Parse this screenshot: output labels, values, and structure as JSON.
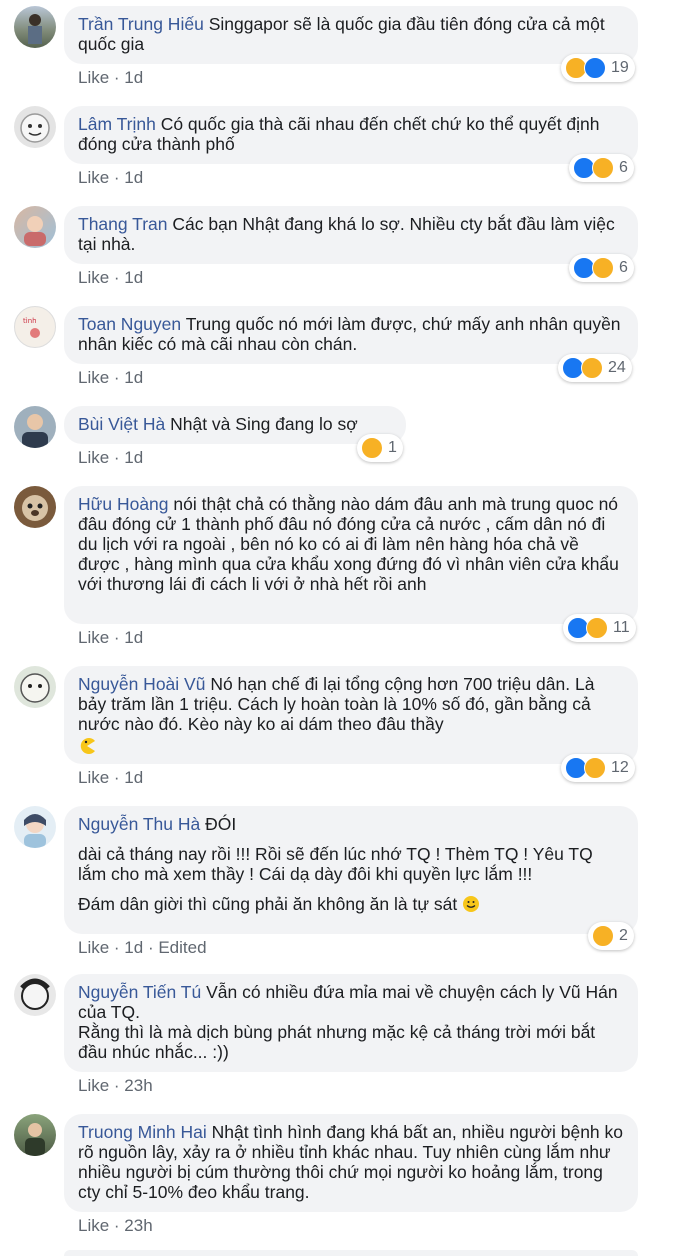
{
  "comments": [
    {
      "author": "Trần Trung Hiếu",
      "text": "Singgapor sẽ là quốc gia đầu tiên đóng cửa cả một quốc gia",
      "like": "Like",
      "time": "1d",
      "reactions": [
        "haha",
        "like"
      ],
      "count": "19"
    },
    {
      "author": "Lâm Trịnh",
      "text": "Có quốc gia thà cãi nhau đến chết chứ ko thể quyết định đóng cửa thành phố",
      "like": "Like",
      "time": "1d",
      "reactions": [
        "like",
        "haha"
      ],
      "count": "6"
    },
    {
      "author": "Thang Tran",
      "text": "Các bạn Nhật đang khá lo sợ. Nhiều cty bắt đầu làm việc tại nhà.",
      "like": "Like",
      "time": "1d",
      "reactions": [
        "like",
        "haha"
      ],
      "count": "6"
    },
    {
      "author": "Toan Nguyen",
      "text": "Trung quốc nó mới làm được, chứ mấy anh nhân quyền nhân kiếc có mà cãi nhau còn chán.",
      "like": "Like",
      "time": "1d",
      "reactions": [
        "like",
        "haha"
      ],
      "count": "24"
    },
    {
      "author": "Bùi Việt Hà",
      "text": "Nhật và Sing đang lo sợ",
      "like": "Like",
      "time": "1d",
      "reactions": [
        "haha"
      ],
      "count": "1"
    },
    {
      "author": "Hữu Hoàng",
      "text": "nói thật chả có thằng nào dám đâu anh mà trung quoc nó đâu đóng cử 1 thành phố đâu nó đóng cửa cả nước , cấm dân nó đi du lịch với ra ngoài , bên nó ko có ai đi làm nên hàng hóa chả về được , hàng mình qua cửa khẩu xong đứng đó vì nhân viên cửa khẩu với thương lái đi cách li với ở nhà hết rồi anh",
      "like": "Like",
      "time": "1d",
      "reactions": [
        "like",
        "sad"
      ],
      "count": "11"
    },
    {
      "author": "Nguyễn Hoài Vũ",
      "text": "Nó hạn chế đi lại tổng cộng hơn 700 triệu dân. Là bảy trăm lần 1 triệu. Cách ly hoàn toàn là 10% số đó, gần bằng cả nước nào đó. Kèo này ko ai dám theo đâu thầy",
      "like": "Like",
      "time": "1d",
      "reactions": [
        "like",
        "haha"
      ],
      "count": "12"
    },
    {
      "author": "Nguyễn Thu Hà",
      "text": "ĐÓI",
      "text2": "dài cả tháng nay rồi !!! Rồi sẽ đến lúc nhớ TQ ! Thèm TQ ! Yêu TQ lắm cho mà xem thầy ! Cái dạ dày đôi khi quyền lực lắm !!!",
      "text3": "Đám dân giời thì cũng phải ăn không ăn là tự sát",
      "like": "Like",
      "time": "1d",
      "edited": "Edited",
      "reactions": [
        "haha"
      ],
      "count": "2"
    },
    {
      "author": "Nguyễn Tiến Tú",
      "text": "Vẫn có nhiều đứa mỉa mai về chuyện cách ly Vũ Hán của TQ.",
      "text2": "Rằng thì là mà dịch bùng phát nhưng mặc kệ cả tháng trời mới bắt đầu nhúc nhắc... :))",
      "like": "Like",
      "time": "23h"
    },
    {
      "author": "Truong Minh Hai",
      "text": "Nhật tình hình đang khá bất an, nhiều người bệnh ko rõ nguồn lây, xảy ra ở nhiều tỉnh khác nhau. Tuy nhiên cùng lắm như nhiều người bị cúm thường thôi chứ mọi người ko hoảng lắm, trong cty chỉ 5-10% đeo khẩu trang.",
      "like": "Like",
      "time": "23h"
    }
  ],
  "colors": {
    "author": "#385898",
    "bubble": "#f2f3f5",
    "like": "#1877f2",
    "haha": "#f7b125",
    "meta": "#606770"
  }
}
